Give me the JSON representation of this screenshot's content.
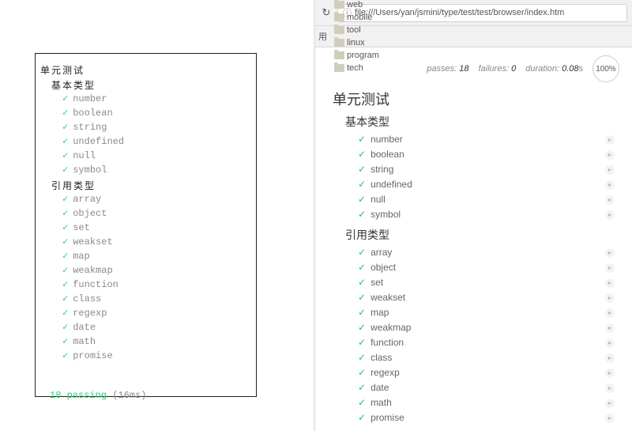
{
  "terminal": {
    "root": "单元测试",
    "groups": [
      {
        "title": "基本类型",
        "items": [
          "number",
          "boolean",
          "string",
          "undefined",
          "null",
          "symbol"
        ]
      },
      {
        "title": "引用类型",
        "items": [
          "array",
          "object",
          "set",
          "weakset",
          "map",
          "weakmap",
          "function",
          "class",
          "regexp",
          "date",
          "math",
          "promise"
        ]
      }
    ],
    "summary_pass": "18 passing",
    "summary_time": "(16ms)"
  },
  "browser": {
    "url": "file:///Users/yan/jsmini/type/test/test/browser/index.htm",
    "bookmarks_prefix": "用",
    "bookmarks": [
      "web",
      "mobile",
      "tool",
      "linux",
      "program",
      "tech"
    ]
  },
  "mocha": {
    "stats": {
      "passes_label": "passes:",
      "passes": "18",
      "failures_label": "failures:",
      "failures": "0",
      "duration_label": "duration:",
      "duration": "0.08",
      "duration_unit": "s",
      "progress": "100%"
    },
    "root": "单元测试",
    "groups": [
      {
        "title": "基本类型",
        "items": [
          "number",
          "boolean",
          "string",
          "undefined",
          "null",
          "symbol"
        ]
      },
      {
        "title": "引用类型",
        "items": [
          "array",
          "object",
          "set",
          "weakset",
          "map",
          "weakmap",
          "function",
          "class",
          "regexp",
          "date",
          "math",
          "promise"
        ]
      }
    ]
  }
}
